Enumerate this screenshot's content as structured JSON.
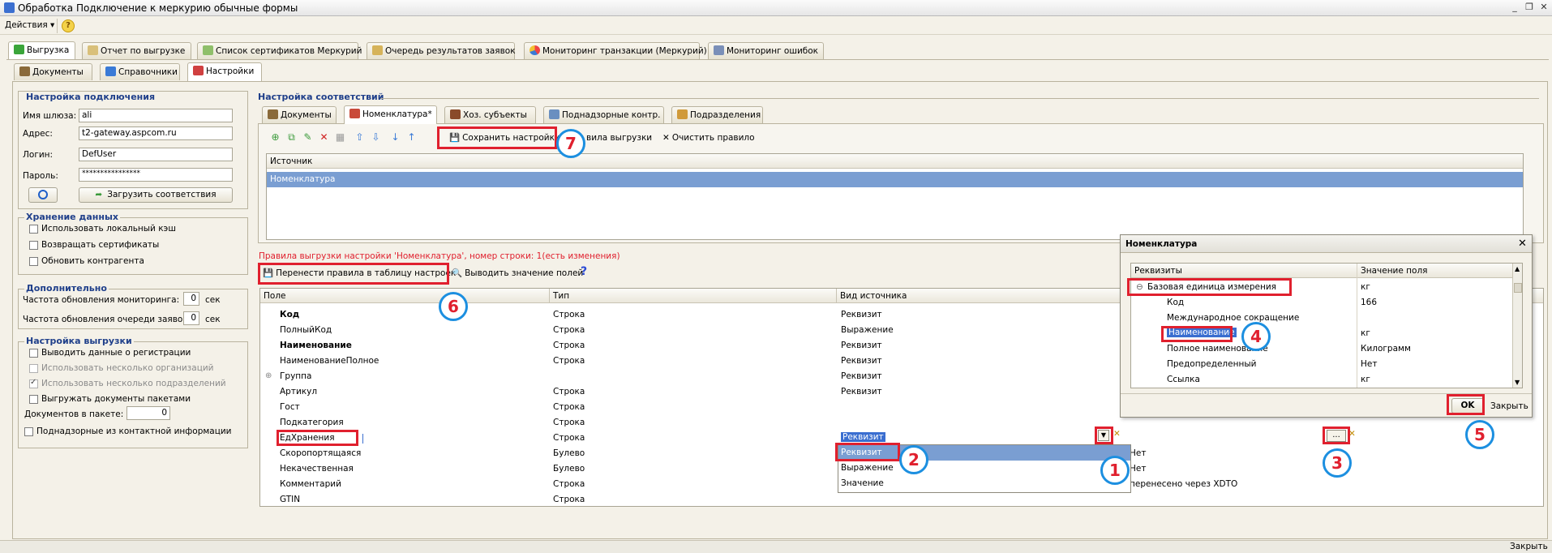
{
  "window": {
    "title": "Обработка  Подключение к меркурию обычные формы",
    "status_close": "Закрыть"
  },
  "menu": {
    "actions": "Действия"
  },
  "top_tabs": [
    "Выгрузка",
    "Отчет по выгрузке",
    "Список сертификатов Меркурий",
    "Очередь результатов заявок",
    "Мониторинг транзакции (Меркурий)",
    "Мониторинг ошибок"
  ],
  "sub_tabs": [
    "Документы",
    "Справочники",
    "Настройки"
  ],
  "connection": {
    "title": "Настройка подключения",
    "gateway_label": "Имя шлюза:",
    "gateway_value": "ali",
    "address_label": "Адрес:",
    "address_value": "t2-gateway.aspcom.ru",
    "login_label": "Логин:",
    "login_value": "DefUser",
    "password_label": "Пароль:",
    "password_value": "****************",
    "load_button": "Загрузить соответствия"
  },
  "storage": {
    "title": "Хранение данных",
    "options": [
      "Использовать локальный кэш",
      "Возвращать сертификаты",
      "Обновить контрагента"
    ]
  },
  "additional": {
    "title": "Дополнительно",
    "monitor_label": "Частота обновления мониторинга:",
    "monitor_value": "0",
    "monitor_unit": "сек",
    "queue_label": "Частота обновления очереди заявок:",
    "queue_value": "0",
    "queue_unit": "сек"
  },
  "export_settings": {
    "title": "Настройка выгрузки",
    "options": [
      "Выводить данные о регистрации",
      "Использовать несколько организаций",
      "Использовать несколько подразделений",
      "Выгружать документы пакетами"
    ],
    "docs_label": "Документов в пакете:",
    "docs_value": "0",
    "supervised": "Поднадзорные из контактной информации"
  },
  "mapping": {
    "title": "Настройка соответствий",
    "tabs": [
      "Документы",
      "Номенклатура*",
      "Хоз. субъекты",
      "Поднадзорные контр.",
      "Подразделения"
    ],
    "save_button": "Сохранить настройки",
    "rules_button": "вила выгрузки",
    "clear_button": "Очистить правило",
    "source_header": "Источник",
    "source_row": "Номенклатура",
    "rules_info": "Правила выгрузки настройки 'Номенклатура', номер строки: 1(есть изменения)",
    "transfer_button": "Перенести правила в таблицу настроек",
    "show_values_button": "Выводить значение полей",
    "columns": [
      "Поле",
      "Тип",
      "Вид источника"
    ],
    "rows": [
      {
        "field": "Код",
        "type": "Строка",
        "kind": "Реквизит",
        "value": "",
        "bold": true
      },
      {
        "field": "ПолныйКод",
        "type": "Строка",
        "kind": "Выражение",
        "value": ""
      },
      {
        "field": "Наименование",
        "type": "Строка",
        "kind": "Реквизит",
        "value": "",
        "bold": true
      },
      {
        "field": "НаименованиеПолное",
        "type": "Строка",
        "kind": "Реквизит",
        "value": ""
      },
      {
        "field": "Группа",
        "type": "",
        "kind": "Реквизит",
        "value": ""
      },
      {
        "field": "Артикул",
        "type": "Строка",
        "kind": "Реквизит",
        "value": ""
      },
      {
        "field": "Гост",
        "type": "Строка",
        "kind": "",
        "value": ""
      },
      {
        "field": "Подкатегория",
        "type": "Строка",
        "kind": "",
        "value": ""
      },
      {
        "field": "ЕдХранения",
        "type": "Строка",
        "kind": "Реквизит",
        "value": ""
      },
      {
        "field": "Скоропортящаяся",
        "type": "Булево",
        "kind": "",
        "value": "Нет"
      },
      {
        "field": "Некачественная",
        "type": "Булево",
        "kind": "",
        "value": "Нет"
      },
      {
        "field": "Комментарий",
        "type": "Строка",
        "kind": "",
        "value": "перенесено через XDTO"
      },
      {
        "field": "GTIN",
        "type": "Строка",
        "kind": "",
        "value": ""
      }
    ],
    "dropdown_options": [
      "Реквизит",
      "Выражение",
      "Значение"
    ],
    "ellipsis": "..."
  },
  "dialog": {
    "title": "Номенклатура",
    "col_attr": "Реквизиты",
    "col_value": "Значение поля",
    "rows": [
      {
        "name": "Базовая единица измерения",
        "value": "кг",
        "level": 0
      },
      {
        "name": "Код",
        "value": "166",
        "level": 1
      },
      {
        "name": "Международное сокращение",
        "value": "",
        "level": 1
      },
      {
        "name": "Наименование",
        "value": "кг",
        "level": 1
      },
      {
        "name": "Полное наименование",
        "value": "Килограмм",
        "level": 1
      },
      {
        "name": "Предопределенный",
        "value": "Нет",
        "level": 1
      },
      {
        "name": "Ссылка",
        "value": "кг",
        "level": 1
      }
    ],
    "ok": "OK",
    "close": "Закрыть"
  },
  "callouts": [
    "1",
    "2",
    "3",
    "4",
    "5",
    "6",
    "7"
  ]
}
